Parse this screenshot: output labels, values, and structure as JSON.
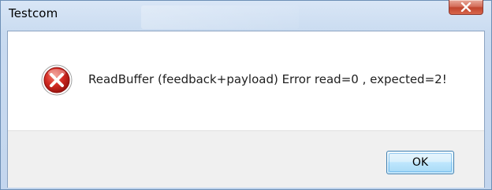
{
  "window": {
    "title": "Testcom"
  },
  "dialog": {
    "icon": "error-icon",
    "message": "ReadBuffer (feedback+payload) Error read=0 , expected=2!",
    "ok_label": "OK"
  },
  "colors": {
    "error_red": "#c8201c",
    "close_button": "#c0452e",
    "footer_bg": "#f0f0f0"
  }
}
